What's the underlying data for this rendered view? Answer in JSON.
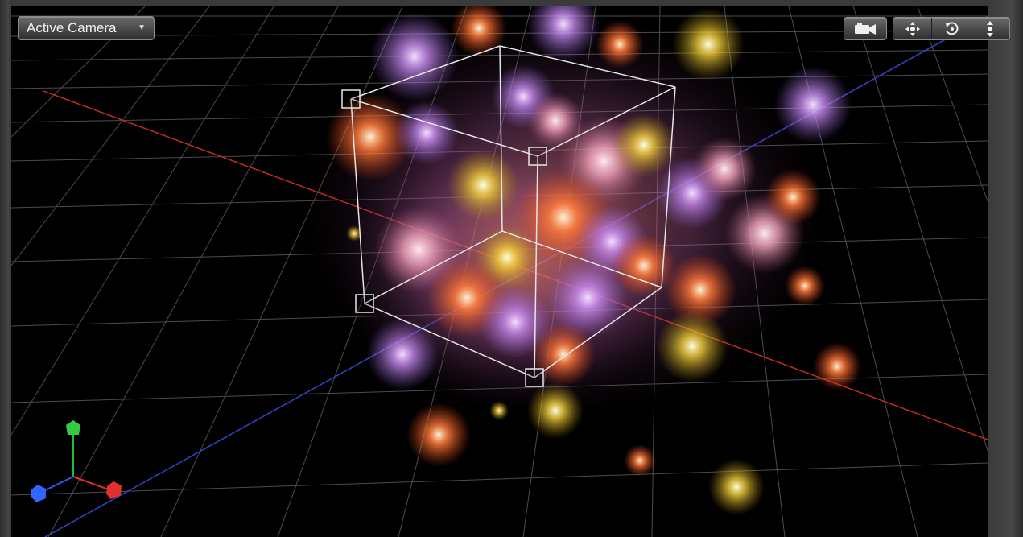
{
  "viewer": {
    "camera_menu": {
      "label": "Active Camera",
      "caret_icon": "chevron-down-icon"
    },
    "toolbar": {
      "camera_view_icon": "video-camera-icon",
      "orbit_icons": [
        "pan-move-icon",
        "orbit-rotate-icon",
        "dolly-icon"
      ]
    },
    "axes": {
      "x_color": "#e03030",
      "y_color": "#22bb33",
      "z_color": "#3355ee"
    },
    "colors": {
      "x_axis_line": "#c42a1e",
      "z_axis_line": "#3344cc",
      "grid": "#5a5a5a",
      "bounding_box": "#e6e6e6"
    }
  }
}
